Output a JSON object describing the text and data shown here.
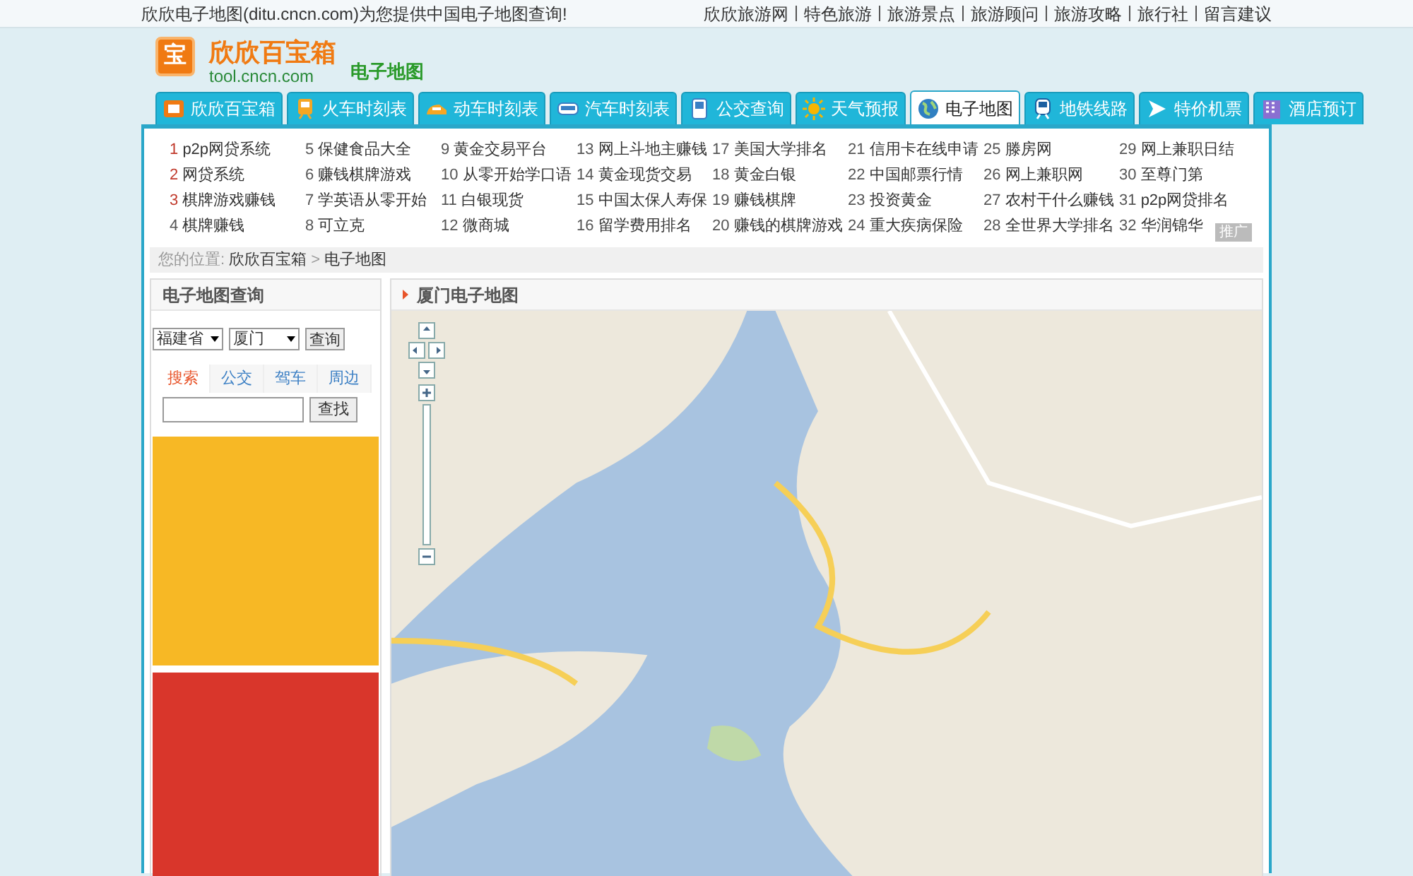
{
  "top_bar": {
    "tagline": "欣欣电子地图(ditu.cncn.com)为您提供中国电子地图查询!",
    "links": [
      "欣欣旅游网",
      "特色旅游",
      "旅游景点",
      "旅游顾问",
      "旅游攻略",
      "旅行社",
      "留言建议"
    ]
  },
  "logo": {
    "mark": "宝",
    "name": "欣欣百宝箱",
    "domain": "tool.cncn.com",
    "section": "电子地图"
  },
  "tabs": [
    {
      "label": "欣欣百宝箱",
      "kind": "box",
      "selected": false
    },
    {
      "label": "火车时刻表",
      "kind": "train",
      "selected": false
    },
    {
      "label": "动车时刻表",
      "kind": "bullet",
      "selected": false
    },
    {
      "label": "汽车时刻表",
      "kind": "bus",
      "selected": false
    },
    {
      "label": "公交查询",
      "kind": "transit",
      "selected": false
    },
    {
      "label": "天气预报",
      "kind": "sun",
      "selected": false
    },
    {
      "label": "电子地图",
      "kind": "globe",
      "selected": true
    },
    {
      "label": "地铁线路",
      "kind": "metro",
      "selected": false
    },
    {
      "label": "特价机票",
      "kind": "plane",
      "selected": false
    },
    {
      "label": "酒店预订",
      "kind": "hotel",
      "selected": false
    }
  ],
  "hot_links": [
    {
      "rank": "1",
      "text": "p2p网贷系统",
      "top": true
    },
    {
      "rank": "2",
      "text": "网贷系统",
      "top": true
    },
    {
      "rank": "3",
      "text": "棋牌游戏赚钱",
      "top": true
    },
    {
      "rank": "4",
      "text": "棋牌赚钱",
      "top": false
    },
    {
      "rank": "5",
      "text": "保健食品大全",
      "top": false
    },
    {
      "rank": "6",
      "text": "赚钱棋牌游戏",
      "top": false
    },
    {
      "rank": "7",
      "text": "学英语从零开始",
      "top": false
    },
    {
      "rank": "8",
      "text": "可立克",
      "top": false
    },
    {
      "rank": "9",
      "text": "黄金交易平台",
      "top": false
    },
    {
      "rank": "10",
      "text": "从零开始学口语",
      "top": false
    },
    {
      "rank": "11",
      "text": "白银现货",
      "top": false
    },
    {
      "rank": "12",
      "text": "微商城",
      "top": false
    },
    {
      "rank": "13",
      "text": "网上斗地主赚钱",
      "top": false
    },
    {
      "rank": "14",
      "text": "黄金现货交易",
      "top": false
    },
    {
      "rank": "15",
      "text": "中国太保人寿保",
      "top": false
    },
    {
      "rank": "16",
      "text": "留学费用排名",
      "top": false
    },
    {
      "rank": "17",
      "text": "美国大学排名",
      "top": false
    },
    {
      "rank": "18",
      "text": "黄金白银",
      "top": false
    },
    {
      "rank": "19",
      "text": "赚钱棋牌",
      "top": false
    },
    {
      "rank": "20",
      "text": "赚钱的棋牌游戏",
      "top": false
    },
    {
      "rank": "21",
      "text": "信用卡在线申请",
      "top": false
    },
    {
      "rank": "22",
      "text": "中国邮票行情",
      "top": false
    },
    {
      "rank": "23",
      "text": "投资黄金",
      "top": false
    },
    {
      "rank": "24",
      "text": "重大疾病保险",
      "top": false
    },
    {
      "rank": "25",
      "text": "滕房网",
      "top": false
    },
    {
      "rank": "26",
      "text": "网上兼职网",
      "top": false
    },
    {
      "rank": "27",
      "text": "农村干什么赚钱",
      "top": false
    },
    {
      "rank": "28",
      "text": "全世界大学排名",
      "top": false
    },
    {
      "rank": "29",
      "text": "网上兼职日结",
      "top": false
    },
    {
      "rank": "30",
      "text": "至尊门第",
      "top": false
    },
    {
      "rank": "31",
      "text": "p2p网贷排名",
      "top": false
    },
    {
      "rank": "32",
      "text": "华润锦华",
      "top": false
    }
  ],
  "ad_badge": "推广",
  "breadcrumb": {
    "label": "您的位置:",
    "items": [
      "欣欣百宝箱",
      "电子地图"
    ],
    "separator": ">"
  },
  "search_panel": {
    "title": "电子地图查询",
    "province": "福建省",
    "city": "厦门",
    "query_button": "查询",
    "tabs": [
      {
        "label": "搜索",
        "selected": true
      },
      {
        "label": "公交",
        "selected": false
      },
      {
        "label": "驾车",
        "selected": false
      },
      {
        "label": "周边",
        "selected": false
      }
    ],
    "find_button": "查找"
  },
  "map_panel": {
    "title": "厦门电子地图"
  }
}
